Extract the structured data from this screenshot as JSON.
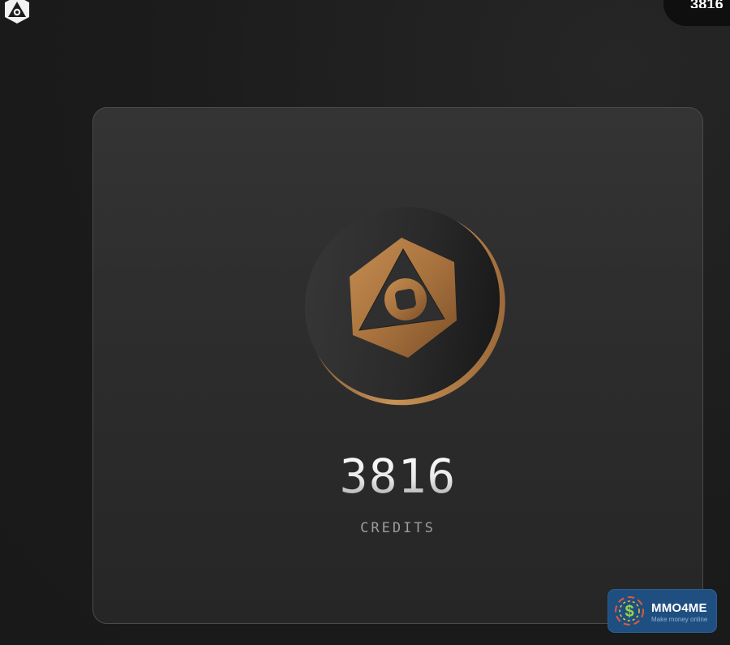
{
  "header": {
    "logo_icon": "hexagon-triangle-logo-icon",
    "credits_value": "3816"
  },
  "card": {
    "coin_icon": "credit-coin-icon",
    "credits_value": "3816",
    "credits_label": "CREDITS"
  },
  "watermark": {
    "icon": "dollar-coin-icon",
    "title": "MMO4ME",
    "subtitle": "Make money online"
  },
  "colors": {
    "background": "#1b1b1b",
    "card": "#2e2e2e",
    "coin_gold": "#b8824a",
    "badge": "#1f4f80"
  }
}
